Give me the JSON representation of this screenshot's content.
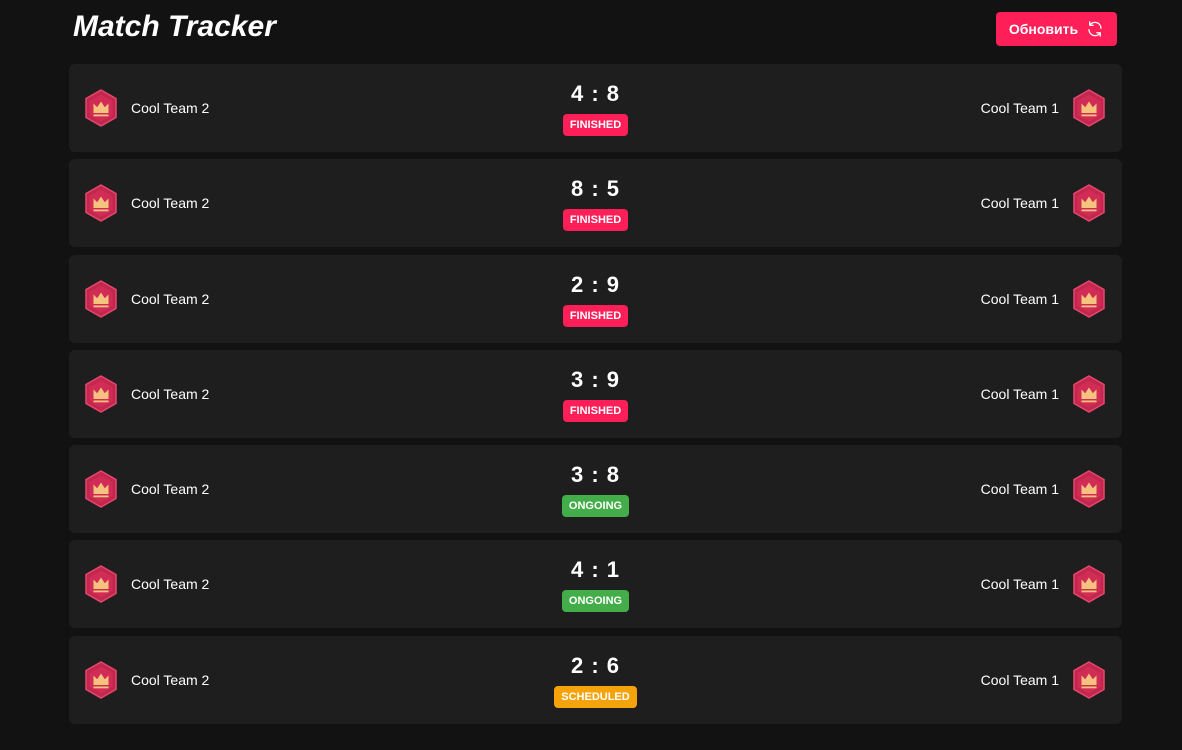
{
  "header": {
    "title": "Match Tracker",
    "refresh_label": "Обновить",
    "refresh_icon": "refresh-icon"
  },
  "colors": {
    "background": "#121212",
    "row": "#1e1e1e",
    "accent": "#ff1f58",
    "finished": "#ff1f58",
    "ongoing": "#43ad49",
    "scheduled": "#f5a30a",
    "logo_fill": "#c2274e",
    "logo_crown": "#f6c37e"
  },
  "matches": [
    {
      "home_team": "Cool Team 2",
      "away_team": "Cool Team 1",
      "score": "4 : 8",
      "status": "FINISHED",
      "status_key": "finished"
    },
    {
      "home_team": "Cool Team 2",
      "away_team": "Cool Team 1",
      "score": "8 : 5",
      "status": "FINISHED",
      "status_key": "finished"
    },
    {
      "home_team": "Cool Team 2",
      "away_team": "Cool Team 1",
      "score": "2 : 9",
      "status": "FINISHED",
      "status_key": "finished"
    },
    {
      "home_team": "Cool Team 2",
      "away_team": "Cool Team 1",
      "score": "3 : 9",
      "status": "FINISHED",
      "status_key": "finished"
    },
    {
      "home_team": "Cool Team 2",
      "away_team": "Cool Team 1",
      "score": "3 : 8",
      "status": "ONGOING",
      "status_key": "ongoing"
    },
    {
      "home_team": "Cool Team 2",
      "away_team": "Cool Team 1",
      "score": "4 : 1",
      "status": "ONGOING",
      "status_key": "ongoing"
    },
    {
      "home_team": "Cool Team 2",
      "away_team": "Cool Team 1",
      "score": "2 : 6",
      "status": "SCHEDULED",
      "status_key": "scheduled"
    }
  ]
}
